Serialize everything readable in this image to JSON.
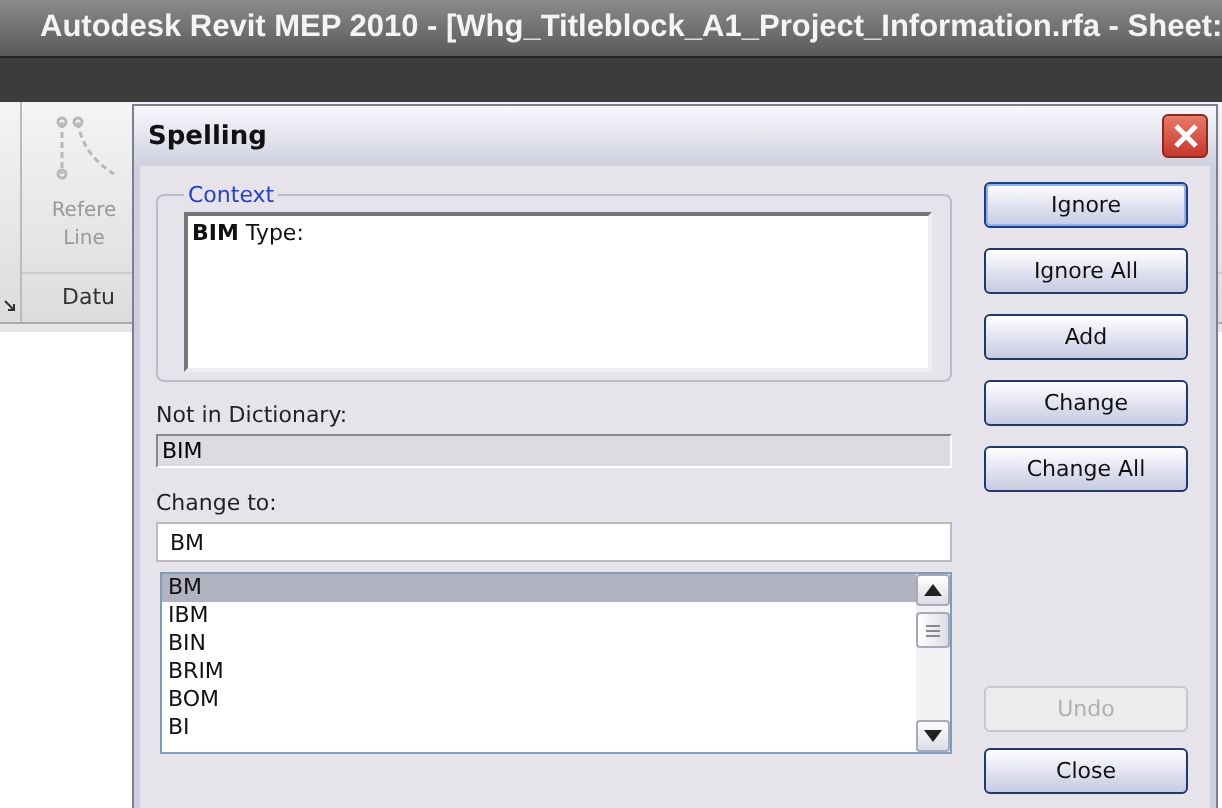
{
  "window": {
    "title": "Autodesk Revit MEP 2010 - [Whg_Titleblock_A1_Project_Information.rfa - Sheet:"
  },
  "ribbon": {
    "tool_label_1": "Refere",
    "tool_label_2": "Line",
    "panel_label": "Datu"
  },
  "dialog": {
    "title": "Spelling",
    "context": {
      "legend": "Context",
      "text": "**BIM** Type:"
    },
    "not_in_dictionary": {
      "label": "Not in Dictionary:",
      "value": "BIM"
    },
    "change_to": {
      "label": "Change to:",
      "value": "BM"
    },
    "suggestions": [
      {
        "text": "BM",
        "selected": true
      },
      {
        "text": "IBM",
        "selected": false
      },
      {
        "text": "BIN",
        "selected": false
      },
      {
        "text": "BRIM",
        "selected": false
      },
      {
        "text": "BOM",
        "selected": false
      },
      {
        "text": "BI",
        "selected": false
      }
    ],
    "buttons": [
      {
        "label": "Ignore",
        "disabled": false,
        "default": true
      },
      {
        "label": "Ignore All",
        "disabled": false,
        "default": false
      },
      {
        "label": "Add",
        "disabled": false,
        "default": false
      },
      {
        "label": "Change",
        "disabled": false,
        "default": false
      },
      {
        "label": "Change All",
        "disabled": false,
        "default": false
      }
    ],
    "bottom_buttons": [
      {
        "label": "Undo",
        "disabled": true,
        "default": false
      },
      {
        "label": "Close",
        "disabled": false,
        "default": false
      }
    ]
  }
}
